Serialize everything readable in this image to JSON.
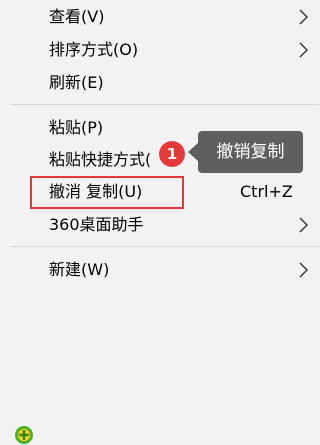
{
  "menu": {
    "items": [
      {
        "label": "查看(V)",
        "has_submenu": true
      },
      {
        "label": "排序方式(O)",
        "has_submenu": true
      },
      {
        "label": "刷新(E)",
        "has_submenu": false
      },
      {
        "label": "粘贴(P)",
        "has_submenu": false
      },
      {
        "label": "粘贴快捷方式(",
        "has_submenu": false
      },
      {
        "label": "撤消 复制(U)",
        "shortcut": "Ctrl+Z",
        "highlighted": true
      },
      {
        "label": "360桌面助手",
        "has_submenu": true,
        "icon": "360-assistant-icon"
      },
      {
        "label": "新建(W)",
        "has_submenu": true
      }
    ]
  },
  "annotation": {
    "step_number": "1",
    "tooltip": "撤销复制",
    "color": "#e23a3a"
  }
}
